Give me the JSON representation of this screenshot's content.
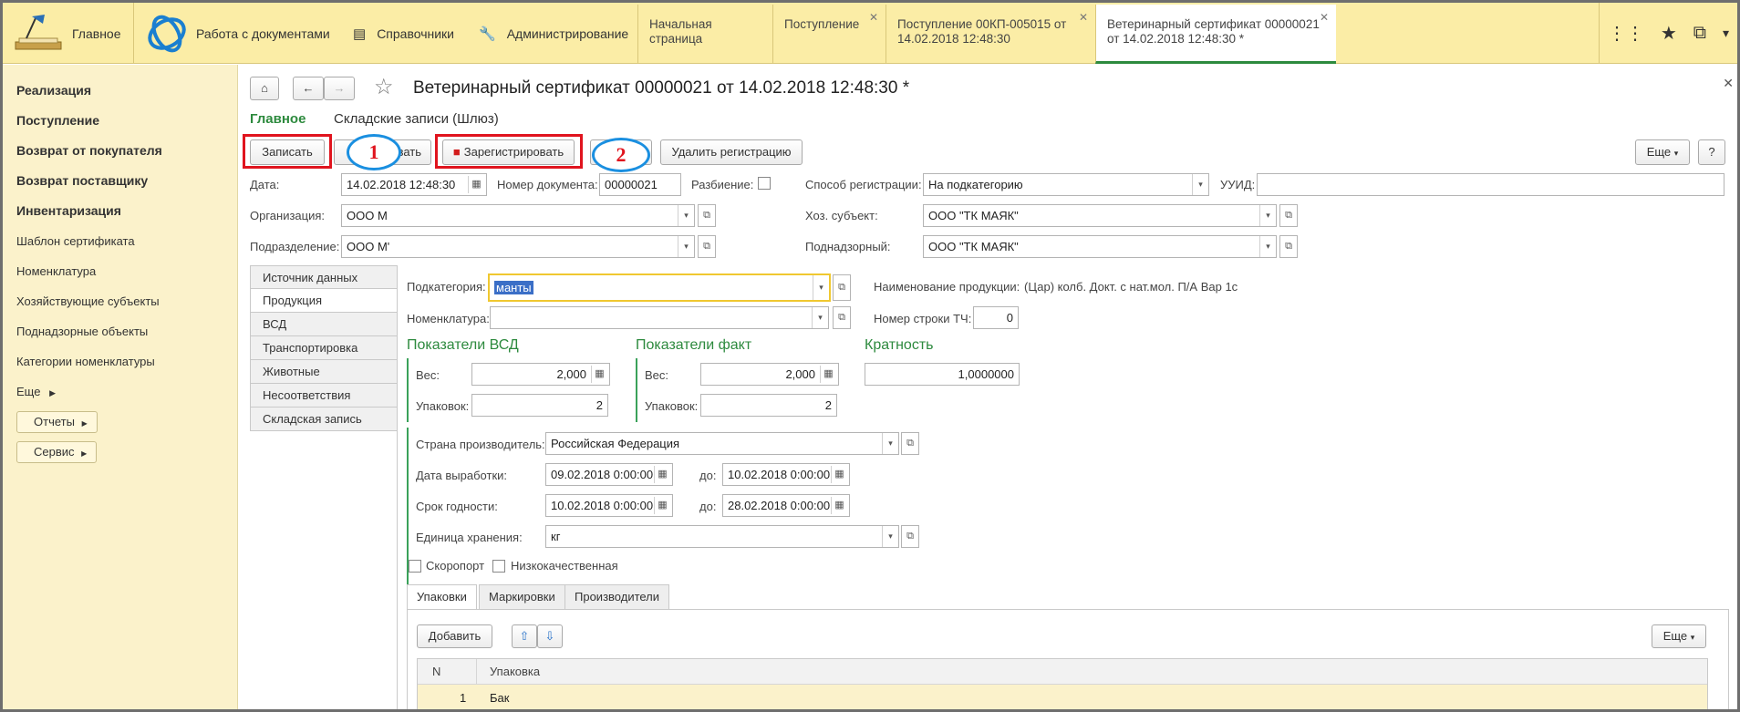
{
  "topbar": {
    "home": "Главное",
    "docs": "Работа с документами",
    "refs": "Справочники",
    "admin": "Администрирование",
    "tabs": [
      {
        "label": "Начальная страница"
      },
      {
        "label": "Поступление"
      },
      {
        "label": "Поступление 00КП-005015 от 14.02.2018 12:48:30"
      },
      {
        "label": "Ветеринарный сертификат 00000021 от 14.02.2018 12:48:30 *"
      }
    ]
  },
  "sidebar": {
    "items": [
      "Реализация",
      "Поступление",
      "Возврат от покупателя",
      "Возврат поставщику",
      "Инвентаризация",
      "Шаблон сертификата",
      "Номенклатура",
      "Хозяйствующие субъекты",
      "Поднадзорные объекты",
      "Категории номенклатуры",
      "Еще"
    ],
    "reports": "Отчеты",
    "service": "Сервис"
  },
  "doc": {
    "title": "Ветеринарный сертификат 00000021 от 14.02.2018 12:48:30 *",
    "nav_main": "Главное",
    "nav_store": "Складские записи (Шлюз)"
  },
  "toolbar": {
    "write": "Записать",
    "post_partial": "вать",
    "register": "Зарегистрировать",
    "unregister": "Удалить регистрацию",
    "more": "Еще",
    "help": "?"
  },
  "annotations": {
    "one": "1",
    "two": "2"
  },
  "header": {
    "date_label": "Дата:",
    "date_value": "14.02.2018 12:48:30",
    "docnum_label": "Номер документа:",
    "docnum_value": "00000021",
    "split_label": "Разбиение:",
    "reg_method_label": "Способ регистрации:",
    "reg_method_value": "На подкатегорию",
    "uuid_label": "УУИД:",
    "uuid_value": "",
    "org_label": "Организация:",
    "org_value": "ООО М",
    "subject_label": "Хоз. субъект:",
    "subject_value": "ООО \"ТК МАЯК\"",
    "dept_label": "Подразделение:",
    "dept_value": "ООО М'",
    "supervised_label": "Поднадзорный:",
    "supervised_value": "ООО \"ТК МАЯК\""
  },
  "lefttabs": [
    "Источник данных",
    "Продукция",
    "ВСД",
    "Транспортировка",
    "Животные",
    "Несоответствия",
    "Складская запись"
  ],
  "product": {
    "subcat_label": "Подкатегория:",
    "subcat_value": "манты",
    "prodname_label": "Наименование продукции:",
    "prodname_value": "(Цар) колб. Докт. с нат.мол. П/А Вар 1с",
    "nomen_label": "Номенклатура:",
    "nomen_value": "",
    "rownum_label": "Номер строки ТЧ:",
    "rownum_value": "0",
    "vsd_title": "Показатели ВСД",
    "fact_title": "Показатели факт",
    "mult_title": "Кратность",
    "weight_label": "Вес:",
    "vsd_weight": "2,000",
    "fact_weight": "2,000",
    "mult_value": "1,0000000",
    "packs_label": "Упаковок:",
    "vsd_packs": "2",
    "fact_packs": "2",
    "country_label": "Страна производитель:",
    "country_value": "Российская Федерация",
    "prod_date_label": "Дата выработки:",
    "prod_date_from": "09.02.2018  0:00:00",
    "to_label": "до:",
    "prod_date_to": "10.02.2018  0:00:00",
    "expiry_label": "Срок годности:",
    "expiry_from": "10.02.2018  0:00:00",
    "expiry_to": "28.02.2018  0:00:00",
    "unit_label": "Единица хранения:",
    "unit_value": "кг",
    "perishable_label": "Скоропорт",
    "lowquality_label": "Низкокачественная"
  },
  "subtabs": [
    "Упаковки",
    "Маркировки",
    "Производители"
  ],
  "table": {
    "add": "Добавить",
    "more": "Еще",
    "col_n": "N",
    "col_pack": "Упаковка",
    "rows": [
      {
        "n": "1",
        "pack": "Бак"
      }
    ]
  }
}
